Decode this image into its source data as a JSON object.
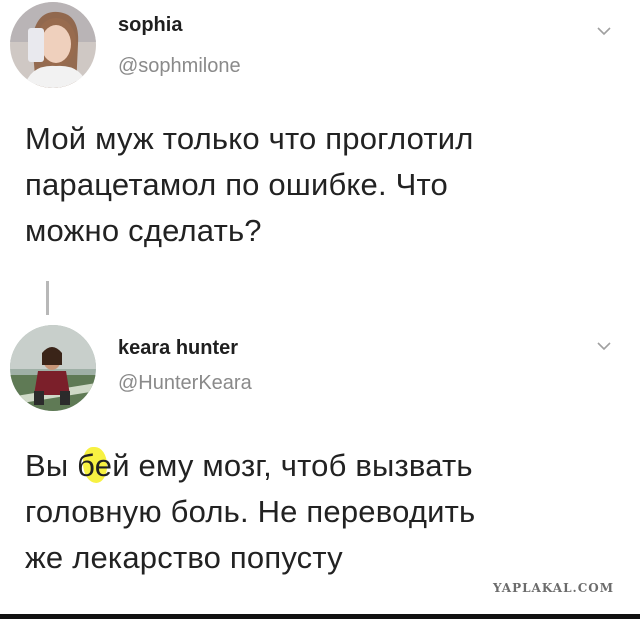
{
  "tweet1": {
    "name": "sophia",
    "handle": "@sophmilone",
    "text": "Мой муж только что проглотил\nпарацетамол по ошибке. Что\nможно сделать?",
    "avatar_icon": "user-photo-avatar",
    "menu_icon": "chevron-down-icon"
  },
  "tweet2": {
    "name": "keara hunter",
    "handle": "@HunterKeara",
    "text": "Вы бей ему мозг, чтоб вызвать\nголовную боль. Не переводить\nже лекарство попусту",
    "avatar_icon": "user-photo-avatar",
    "menu_icon": "chevron-down-icon"
  },
  "watermark": "YAPLAKAL.COM",
  "colors": {
    "highlight": "#f6ef2e",
    "handle": "#8a8a8a",
    "text": "#222222"
  }
}
